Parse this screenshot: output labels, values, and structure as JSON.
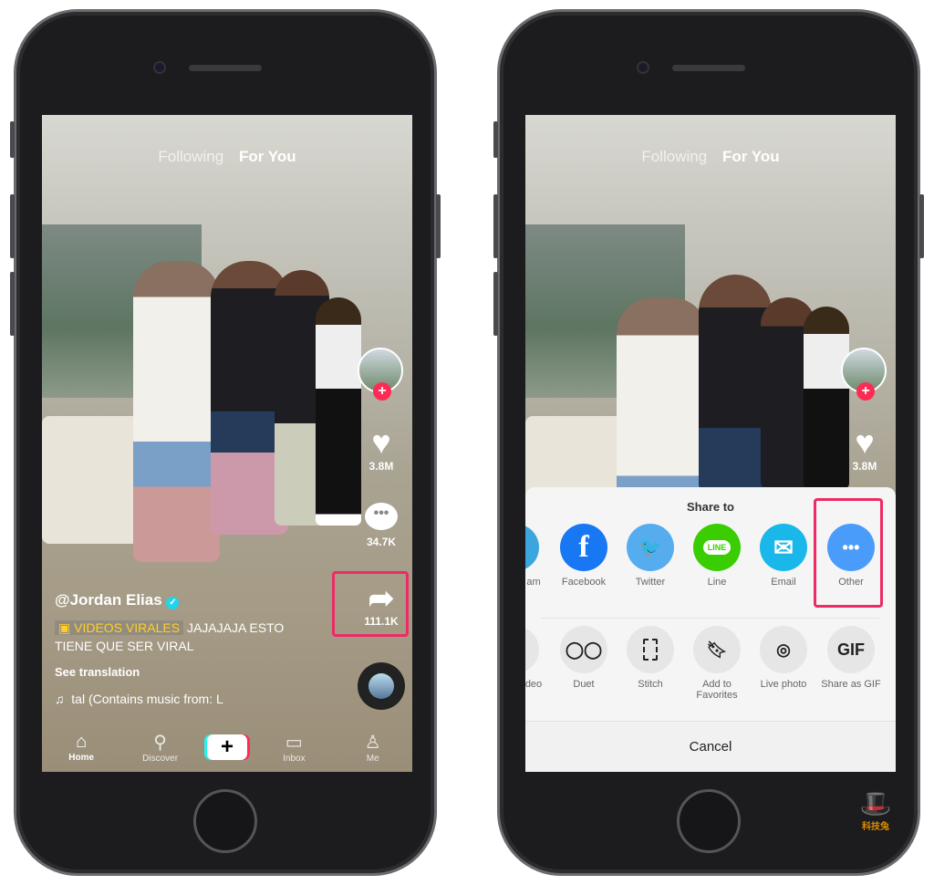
{
  "left_phone": {
    "top_nav": {
      "following": "Following",
      "for_you": "For You"
    },
    "likes": "3.8M",
    "comments": "34.7K",
    "shares": "111.1K",
    "username": "@Jordan Elias",
    "tag": "VIDEOS VIRALES",
    "caption_rest": "JAJAJAJA ESTO TIENE QUE SER VIRAL",
    "see_translation": "See translation",
    "music": "tal (Contains music from: L",
    "nav": {
      "home": "Home",
      "discover": "Discover",
      "create": "+",
      "inbox": "Inbox",
      "me": "Me"
    }
  },
  "right_phone": {
    "top_nav": {
      "following": "Following",
      "for_you": "For You"
    },
    "likes": "3.8M",
    "sheet": {
      "title": "Share to",
      "share_targets": [
        {
          "label": "am",
          "color": "#3aa6dd"
        },
        {
          "label": "Facebook",
          "color": "#1877f2"
        },
        {
          "label": "Twitter",
          "color": "#55acee"
        },
        {
          "label": "Line",
          "color": "#3acd01"
        },
        {
          "label": "Email",
          "color": "#1ab7ea"
        },
        {
          "label": "Other",
          "color": "#4a9cfb"
        }
      ],
      "actions": [
        "deo",
        "Duet",
        "Stitch",
        "Add to Favorites",
        "Live photo",
        "Share as GIF"
      ],
      "gif_glyph": "GIF",
      "line_glyph": "LINE",
      "cancel": "Cancel"
    }
  },
  "watermark": "科技兔",
  "highlight_color": "#ee2a65"
}
